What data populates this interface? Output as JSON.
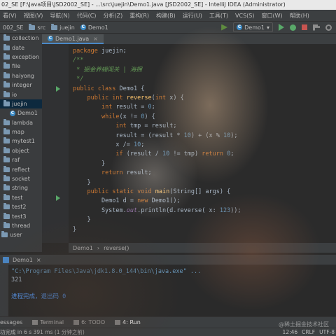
{
  "window": {
    "title": "02_SE [F:\\Java项目\\JSD2002_SE] - ...\\src\\juejin\\Demo1.java [JSD2002_SE] - IntelliJ IDEA (Administrator)"
  },
  "menu": [
    "看(V)",
    "视图(V)",
    "导航(N)",
    "代码(C)",
    "分析(Z)",
    "重构(R)",
    "构建(B)",
    "运行(U)",
    "工具(T)",
    "VCS(S)",
    "窗口(W)",
    "帮助(H)"
  ],
  "nav": {
    "crumbs": [
      "002_SE",
      "src",
      "juejin",
      "Demo1"
    ],
    "run_config": "Demo1"
  },
  "project_tree": [
    {
      "label": "collection",
      "type": "folder"
    },
    {
      "label": "date",
      "type": "folder"
    },
    {
      "label": "exception",
      "type": "folder"
    },
    {
      "label": "file",
      "type": "folder"
    },
    {
      "label": "haiyong",
      "type": "folder"
    },
    {
      "label": "integer",
      "type": "folder"
    },
    {
      "label": "io",
      "type": "folder"
    },
    {
      "label": "juejin",
      "type": "folder",
      "selected": true
    },
    {
      "label": "Demo1",
      "type": "class",
      "child": true
    },
    {
      "label": "lambda",
      "type": "folder"
    },
    {
      "label": "map",
      "type": "folder"
    },
    {
      "label": "mytest1",
      "type": "folder"
    },
    {
      "label": "object",
      "type": "folder"
    },
    {
      "label": "raf",
      "type": "folder"
    },
    {
      "label": "reflect",
      "type": "folder"
    },
    {
      "label": "socket",
      "type": "folder"
    },
    {
      "label": "string",
      "type": "folder"
    },
    {
      "label": "test",
      "type": "folder"
    },
    {
      "label": "test2",
      "type": "folder"
    },
    {
      "label": "test3",
      "type": "folder"
    },
    {
      "label": "thread",
      "type": "folder"
    },
    {
      "label": "user",
      "type": "folder",
      "root": true
    }
  ],
  "editor": {
    "tab": "Demo1.java",
    "lines": [
      [
        [
          "kw",
          "package "
        ],
        [
          "pl",
          "juejin;"
        ]
      ],
      [
        [
          "cm",
          "/**"
        ]
      ],
      [
        [
          "cm",
          " * 掘金养蝴闯关 | 海拥"
        ]
      ],
      [
        [
          "cm",
          " */"
        ]
      ],
      [
        [
          "kw",
          "public class "
        ],
        [
          "pl",
          "Demo1 {"
        ]
      ],
      [
        [
          "pl",
          "    "
        ],
        [
          "kw",
          "public int "
        ],
        [
          "fn",
          "reverse"
        ],
        [
          "pl",
          "("
        ],
        [
          "kw",
          "int "
        ],
        [
          "pl",
          "x) {"
        ]
      ],
      [
        [
          "pl",
          "        "
        ],
        [
          "kw",
          "int "
        ],
        [
          "pl",
          "result = "
        ],
        [
          "num",
          "0"
        ],
        [
          "pl",
          ";"
        ]
      ],
      [
        [
          "pl",
          "        "
        ],
        [
          "kw",
          "while"
        ],
        [
          "pl",
          "(x != "
        ],
        [
          "num",
          "0"
        ],
        [
          "pl",
          ") {"
        ]
      ],
      [
        [
          "pl",
          "            "
        ],
        [
          "kw",
          "int "
        ],
        [
          "pl",
          "tmp = result;"
        ]
      ],
      [
        [
          "pl",
          "            result = (result * "
        ],
        [
          "num",
          "10"
        ],
        [
          "pl",
          ") + (x % "
        ],
        [
          "num",
          "10"
        ],
        [
          "pl",
          ");"
        ]
      ],
      [
        [
          "pl",
          "            x /= "
        ],
        [
          "num",
          "10"
        ],
        [
          "pl",
          ";"
        ]
      ],
      [
        [
          "pl",
          "            "
        ],
        [
          "kw",
          "if "
        ],
        [
          "pl",
          "(result / "
        ],
        [
          "num",
          "10"
        ],
        [
          "pl",
          " != tmp) "
        ],
        [
          "kw",
          "return "
        ],
        [
          "num",
          "0"
        ],
        [
          "pl",
          ";"
        ]
      ],
      [
        [
          "pl",
          "        }"
        ]
      ],
      [
        [
          "pl",
          "        "
        ],
        [
          "kw",
          "return "
        ],
        [
          "pl",
          "result;"
        ]
      ],
      [
        [
          "pl",
          "    }"
        ]
      ],
      [
        [
          "pl",
          "    "
        ],
        [
          "kw",
          "public static void "
        ],
        [
          "fn",
          "main"
        ],
        [
          "pl",
          "(String[] args) {"
        ]
      ],
      [
        [
          "pl",
          "        Demo1 d = "
        ],
        [
          "kw",
          "new "
        ],
        [
          "pl",
          "Demo1();"
        ]
      ],
      [
        [
          "pl",
          "        System."
        ],
        [
          "st",
          "out"
        ],
        [
          "pl",
          ".println(d.reverse( x: "
        ],
        [
          "num",
          "123"
        ],
        [
          "pl",
          "));"
        ]
      ],
      [
        [
          "pl",
          "    }"
        ]
      ],
      [
        [
          "pl",
          "}"
        ]
      ]
    ],
    "breadcrumb": [
      "Demo1",
      "reverse()"
    ]
  },
  "run": {
    "title": "Demo1",
    "console": [
      {
        "kind": "c-cmd",
        "text": "\"C:\\Program Files\\Java\\jdk1.8.0_144\\bin\\java.exe\" ..."
      },
      {
        "kind": "c-out",
        "text": "321"
      },
      {
        "kind": "c-out",
        "text": ""
      },
      {
        "kind": "c-done",
        "text": "进程完成，退出码 0"
      }
    ]
  },
  "tool_windows": [
    {
      "label": "essages",
      "active": false
    },
    {
      "label": "Terminal",
      "active": false
    },
    {
      "label": "6: TODO",
      "active": false
    },
    {
      "label": "4: Run",
      "active": true
    }
  ],
  "status": {
    "message": "功完成 in 6 s 391 ms (1 分钟之前)",
    "position": "12:46",
    "line_sep": "CRLF",
    "encoding": "UTF-8"
  },
  "watermark": "@稀土掘金技术社区",
  "colors": {
    "keyword": "#cc7832",
    "comment": "#629755",
    "method": "#ffc66d",
    "number": "#6897bb",
    "accent": "#4a88c7",
    "run_green": "#59a869"
  }
}
